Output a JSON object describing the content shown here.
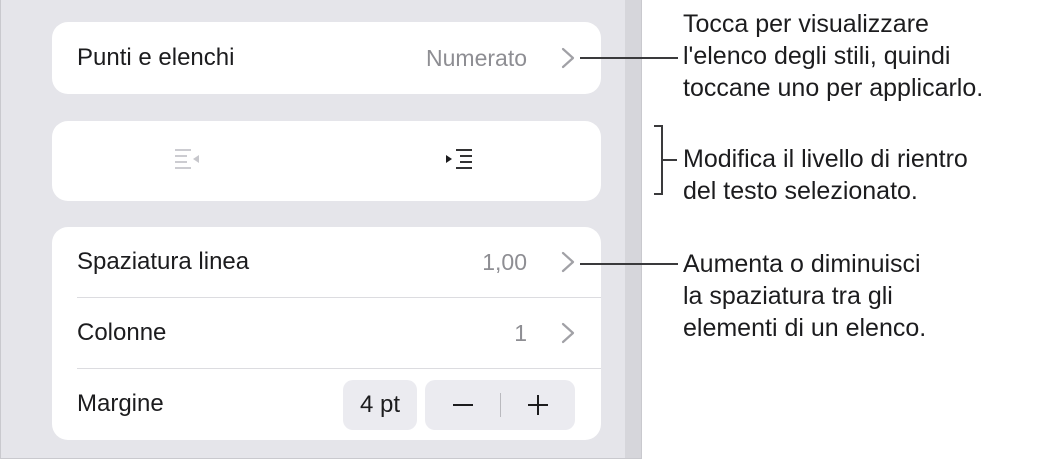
{
  "panel": {
    "bullets_row": {
      "label": "Punti e elenchi",
      "value": "Numerato",
      "icon": "chevron-right-icon"
    },
    "indent_row": {
      "decrease_icon": "outdent-icon",
      "increase_icon": "indent-icon",
      "decrease_enabled": false,
      "increase_enabled": true
    },
    "line_spacing_row": {
      "label": "Spaziatura linea",
      "value": "1,00",
      "icon": "chevron-right-icon"
    },
    "columns_row": {
      "label": "Colonne",
      "value": "1",
      "icon": "chevron-right-icon"
    },
    "margin_row": {
      "label": "Margine",
      "value": "4 pt",
      "minus": "−",
      "plus": "+"
    }
  },
  "callouts": {
    "bullets": [
      "Tocca per visualizzare",
      "l'elenco degli stili, quindi",
      "toccane uno per applicarlo."
    ],
    "indent": [
      "Modifica il livello di rientro",
      "del testo selezionato."
    ],
    "spacing": [
      "Aumenta o diminuisci",
      "la spaziatura tra gli",
      "elementi di un elenco."
    ]
  },
  "colors": {
    "panel_bg": "#e5e5ea",
    "card_bg": "#ffffff",
    "secondary_text": "#8e8e93",
    "disabled_icon": "#c7c7cc"
  }
}
